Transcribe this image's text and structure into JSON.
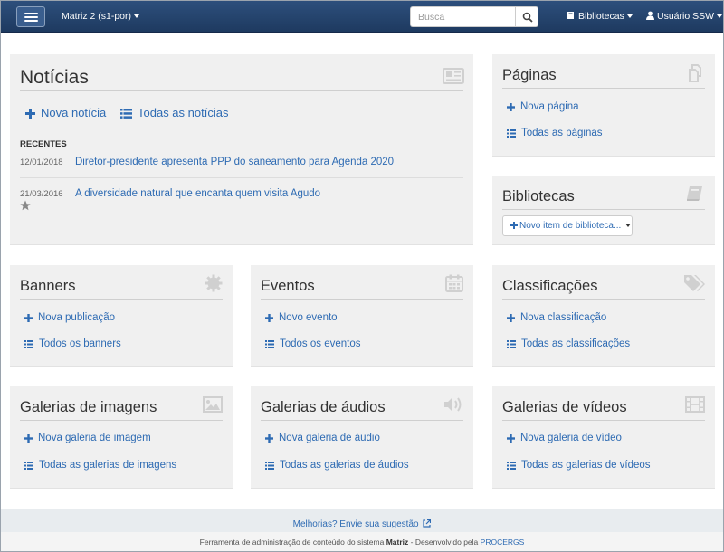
{
  "navbar": {
    "brand": "Matriz 2 (s1-por)",
    "search_placeholder": "Busca",
    "libraries_label": "Bibliotecas",
    "user_label": "Usuário SSW"
  },
  "noticias": {
    "title": "Notícias",
    "new_label": "Nova notícia",
    "all_label": "Todas as notícias",
    "recent_label": "RECENTES",
    "items": [
      {
        "date": "12/01/2018",
        "title": "Diretor-presidente apresenta PPP do saneamento para Agenda 2020"
      },
      {
        "date": "21/03/2016",
        "title": "A diversidade natural que encanta quem visita Agudo"
      }
    ]
  },
  "paginas": {
    "title": "Páginas",
    "new_label": "Nova página",
    "all_label": "Todas as páginas"
  },
  "bibliotecas": {
    "title": "Bibliotecas",
    "button_label": "Novo item de biblioteca..."
  },
  "banners": {
    "title": "Banners",
    "new_label": "Nova publicação",
    "all_label": "Todos os banners"
  },
  "eventos": {
    "title": "Eventos",
    "new_label": "Novo evento",
    "all_label": "Todos os eventos"
  },
  "classificacoes": {
    "title": "Classificações",
    "new_label": "Nova classificação",
    "all_label": "Todas as classificações"
  },
  "galerias_imagens": {
    "title": "Galerias de imagens",
    "new_label": "Nova galeria de imagem",
    "all_label": "Todas as galerias de imagens"
  },
  "galerias_audios": {
    "title": "Galerias de áudios",
    "new_label": "Nova galeria de áudio",
    "all_label": "Todas as galerias de áudios"
  },
  "galerias_videos": {
    "title": "Galerias de vídeos",
    "new_label": "Nova galeria de vídeo",
    "all_label": "Todas as galerias de vídeos"
  },
  "footer": {
    "suggestion_label": "Melhorias? Envie sua sugestão",
    "credits_prefix": "Ferramenta de administração de conteúdo do sistema",
    "credits_system": "Matriz",
    "credits_mid": "- Desenvolvido pela",
    "credits_company": "PROCERGS"
  },
  "colors": {
    "navbar": "#1e3a60",
    "link": "#2e6bb3",
    "panel": "#f0f0f0"
  }
}
